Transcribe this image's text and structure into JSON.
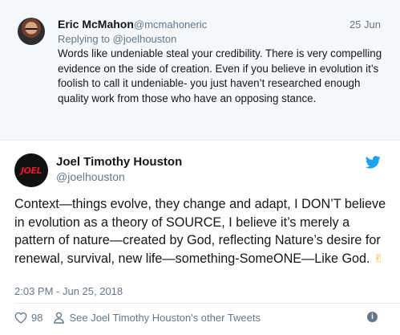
{
  "reply_tweet": {
    "name": "Eric McMahon",
    "handle": "@mcmahoneric",
    "date": "25 Jun",
    "replying_to": "Replying to @joelhouston",
    "text": "Words like undeniable steal your credibility. There is very compelling evidence on the side of creation. Even if you believe in evolution it’s foolish to call it undeniable- you just haven’t researched enough quality work from those who have an opposing stance."
  },
  "main_tweet": {
    "name": "Joel Timothy Houston",
    "handle": "@joelhouston",
    "avatar_text": "JOEL",
    "text": "Context—things evolve, they change and adapt, I DON’T believe in evolution as a theory of SOURCE, I believe it’s merely a pattern of nature—created by God, reflecting Nature’s desire for renewal, survival, new life—something-SomeONE—Like God.",
    "emoji": "✌",
    "timestamp": "2:03 PM - Jun 25, 2018"
  },
  "actions": {
    "like_count": "98",
    "see_other_tweets": "See Joel Timothy Houston's other Tweets",
    "info_glyph": "i"
  },
  "icons": {
    "twitter": "twitter-bird-icon",
    "like": "heart-icon",
    "profile": "person-icon",
    "info": "info-icon"
  },
  "colors": {
    "twitter_blue": "#1da1f2",
    "secondary_text": "#657786",
    "reply_background": "#f5f8fa"
  }
}
